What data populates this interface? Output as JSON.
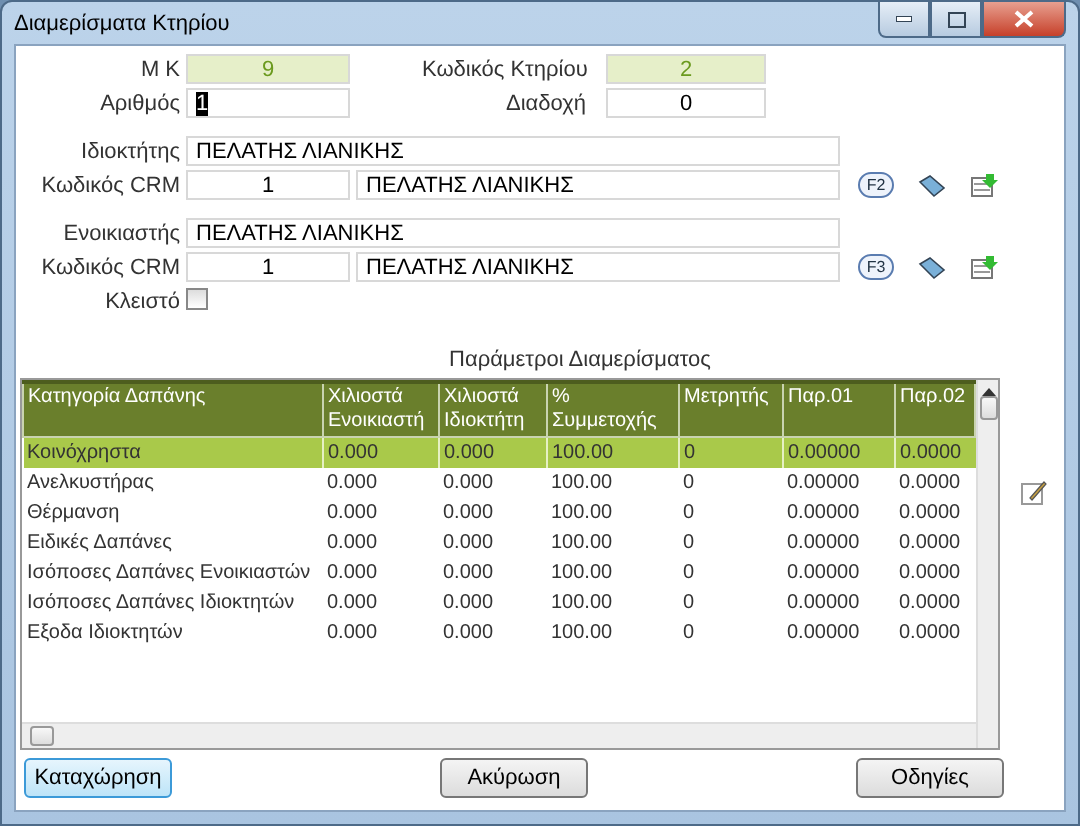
{
  "window": {
    "title": "Διαμερίσματα Κτηρίου"
  },
  "header": {
    "mk": {
      "label": "Μ Κ",
      "value": "9"
    },
    "building_code": {
      "label": "Κωδικός Κτηρίου",
      "value": "2"
    },
    "number": {
      "label": "Αριθμός",
      "value": "1"
    },
    "succession": {
      "label": "Διαδοχή",
      "value": "0"
    }
  },
  "parties": [
    {
      "label": "Ιδιοκτήτης",
      "name": "ΠΕΛΑΤΗΣ ΛΙΑΝΙΚΗΣ",
      "crm_label": "Κωδικός CRM",
      "crm_code": "1",
      "crm_name": "ΠΕΛΑΤΗΣ ΛΙΑΝΙΚΗΣ",
      "key": "F2"
    },
    {
      "label": "Ενοικιαστής",
      "name": "ΠΕΛΑΤΗΣ ΛΙΑΝΙΚΗΣ",
      "crm_label": "Κωδικός CRM",
      "crm_code": "1",
      "crm_name": "ΠΕΛΑΤΗΣ ΛΙΑΝΙΚΗΣ",
      "key": "F3"
    }
  ],
  "closed": {
    "label": "Κλειστό",
    "checked": false
  },
  "table": {
    "title": "Παράμετροι Διαμερίσματος",
    "columns": [
      "Κατηγορία Δαπάνης",
      "Χιλιοστά Ενοικιαστή",
      "Χιλιοστά Ιδιοκτήτη",
      "% Συμμετοχής",
      "Μετρητής",
      "Παρ.01",
      "Παρ.02"
    ],
    "rows": [
      {
        "selected": true,
        "cells": [
          "Κοινόχρηστα",
          "0.000",
          "0.000",
          "100.00",
          "0",
          "0.00000",
          "0.0000"
        ]
      },
      {
        "selected": false,
        "cells": [
          "Ανελκυστήρας",
          "0.000",
          "0.000",
          "100.00",
          "0",
          "0.00000",
          "0.0000"
        ]
      },
      {
        "selected": false,
        "cells": [
          "Θέρμανση",
          "0.000",
          "0.000",
          "100.00",
          "0",
          "0.00000",
          "0.0000"
        ]
      },
      {
        "selected": false,
        "cells": [
          "Ειδικές Δαπάνες",
          "0.000",
          "0.000",
          "100.00",
          "0",
          "0.00000",
          "0.0000"
        ]
      },
      {
        "selected": false,
        "cells": [
          "Ισόποσες Δαπάνες Ενοικιαστών",
          "0.000",
          "0.000",
          "100.00",
          "0",
          "0.00000",
          "0.0000"
        ]
      },
      {
        "selected": false,
        "cells": [
          "Ισόποσες Δαπάνες Ιδιοκτητών",
          "0.000",
          "0.000",
          "100.00",
          "0",
          "0.00000",
          "0.0000"
        ]
      },
      {
        "selected": false,
        "cells": [
          "Εξοδα Ιδιοκτητών",
          "0.000",
          "0.000",
          "100.00",
          "0",
          "0.00000",
          "0.0000"
        ]
      }
    ]
  },
  "buttons": [
    {
      "label": "Καταχώρηση",
      "default": true
    },
    {
      "label": "Ακύρωση",
      "default": false
    },
    {
      "label": "Οδηγίες",
      "default": false
    }
  ]
}
